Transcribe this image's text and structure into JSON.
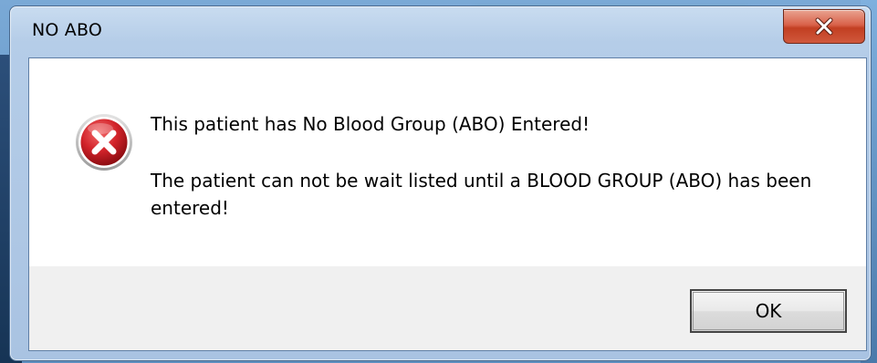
{
  "dialog": {
    "title": "NO ABO",
    "close_label": "×",
    "icon": "error-icon",
    "message_line1": "This patient has No Blood Group (ABO) Entered!",
    "message_line2": "The patient can not be wait listed until a BLOOD GROUP (ABO) has been entered!",
    "ok_label": "OK"
  },
  "colors": {
    "error_red": "#c8202a",
    "close_button_red": "#c94a2c",
    "window_frame": "#b5cde8",
    "button_area": "#f0f0f0"
  }
}
